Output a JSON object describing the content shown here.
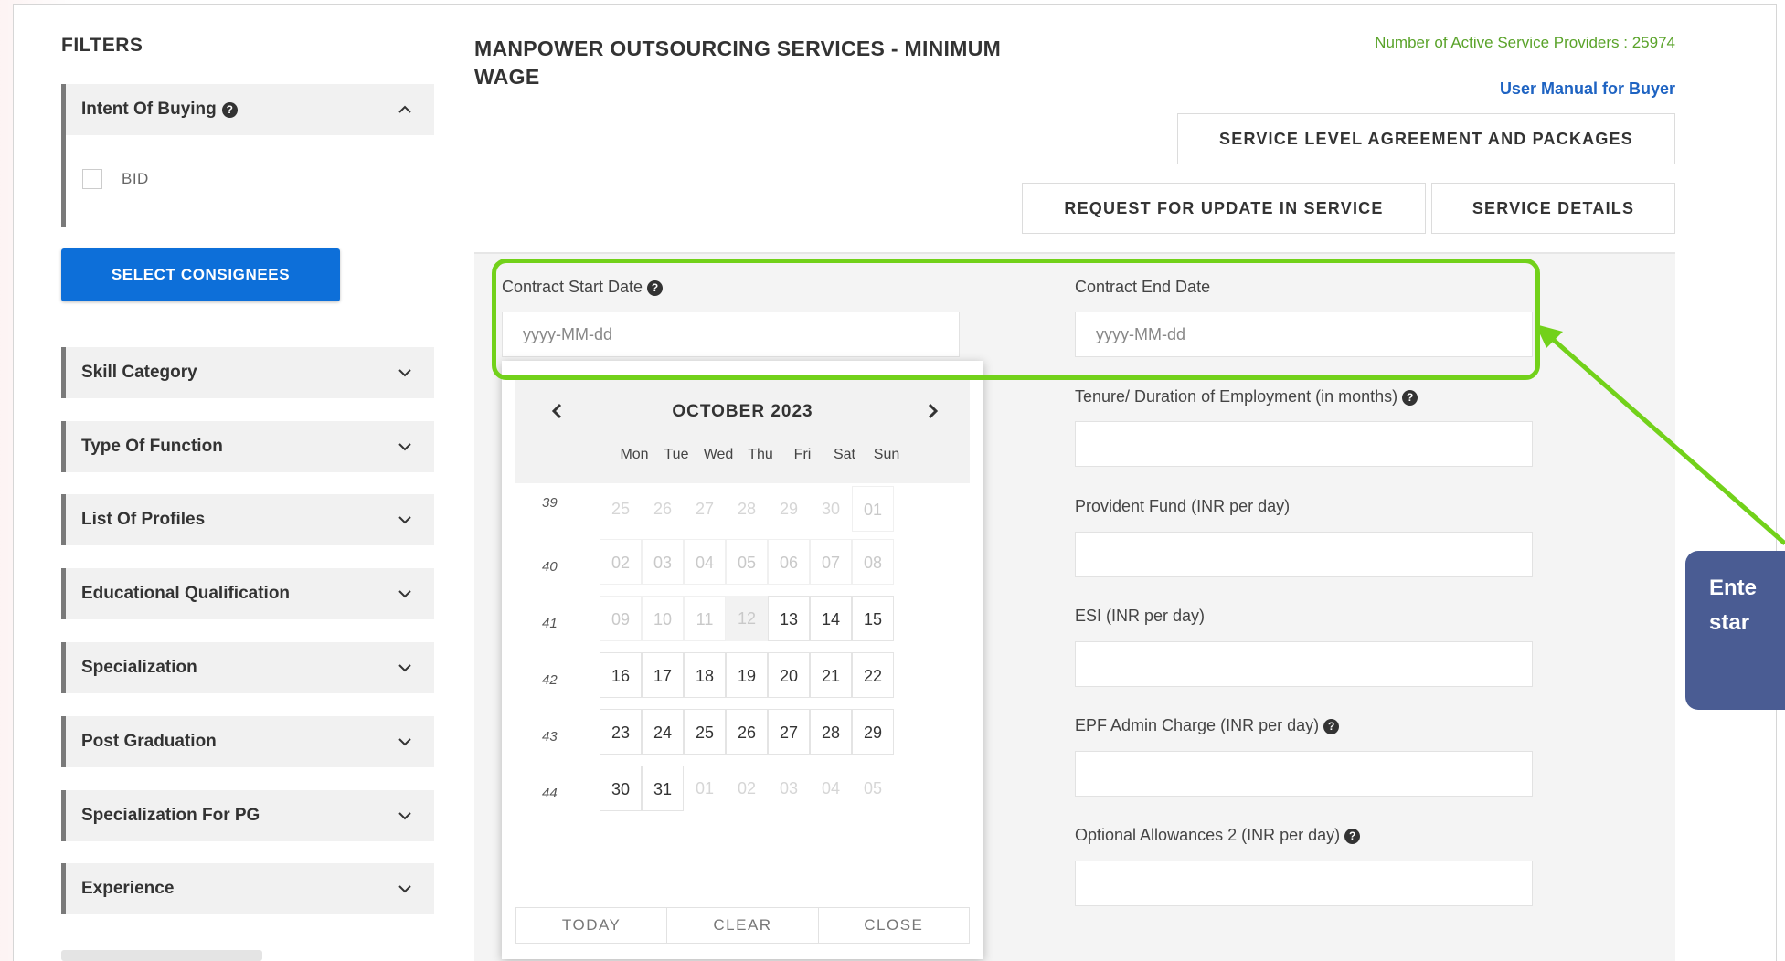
{
  "sidebar": {
    "title": "FILTERS",
    "intent": {
      "label": "Intent Of Buying",
      "help": "?",
      "option": "BID"
    },
    "consignee_button": "SELECT CONSIGNEES",
    "accordions": [
      {
        "label": "Skill Category"
      },
      {
        "label": "Type Of Function"
      },
      {
        "label": "List Of Profiles"
      },
      {
        "label": "Educational Qualification"
      },
      {
        "label": "Specialization"
      },
      {
        "label": "Post Graduation"
      },
      {
        "label": "Specialization For PG"
      },
      {
        "label": "Experience"
      }
    ]
  },
  "header": {
    "title": "MANPOWER OUTSOURCING SERVICES - MINIMUM WAGE",
    "active_providers": "Number of Active Service Providers : 25974",
    "manual_link": "User Manual for Buyer",
    "sla_button": "SERVICE LEVEL AGREEMENT AND PACKAGES",
    "request_button": "REQUEST FOR UPDATE IN SERVICE",
    "details_button": "SERVICE DETAILS"
  },
  "form": {
    "start_label": "Contract Start Date",
    "start_placeholder": "yyyy-MM-dd",
    "end_label": "Contract End Date",
    "end_placeholder": "yyyy-MM-dd",
    "tenure_label": "Tenure/ Duration of Employment (in months)",
    "pf_label": "Provident Fund (INR per day)",
    "esi_label": "ESI (INR per day)",
    "epf_label": "EPF Admin Charge (INR per day)",
    "allow_label": "Optional Allowances 2 (INR per day)",
    "help": "?"
  },
  "datepicker": {
    "month": "OCTOBER 2023",
    "days_of_week": [
      "Mon",
      "Tue",
      "Wed",
      "Thu",
      "Fri",
      "Sat",
      "Sun"
    ],
    "weeks": [
      {
        "num": "39",
        "days": [
          "25",
          "26",
          "27",
          "28",
          "29",
          "30",
          "01"
        ]
      },
      {
        "num": "40",
        "days": [
          "02",
          "03",
          "04",
          "05",
          "06",
          "07",
          "08"
        ]
      },
      {
        "num": "41",
        "days": [
          "09",
          "10",
          "11",
          "12",
          "13",
          "14",
          "15"
        ]
      },
      {
        "num": "42",
        "days": [
          "16",
          "17",
          "18",
          "19",
          "20",
          "21",
          "22"
        ]
      },
      {
        "num": "43",
        "days": [
          "23",
          "24",
          "25",
          "26",
          "27",
          "28",
          "29"
        ]
      },
      {
        "num": "44",
        "days": [
          "30",
          "31",
          "01",
          "02",
          "03",
          "04",
          "05"
        ]
      }
    ],
    "footer": {
      "today": "TODAY",
      "clear": "CLEAR",
      "close": "CLOSE"
    }
  },
  "annotation": {
    "line1": "Ente",
    "line2": "star",
    "color": "#4a5c93",
    "highlight_color": "#72d11a"
  }
}
